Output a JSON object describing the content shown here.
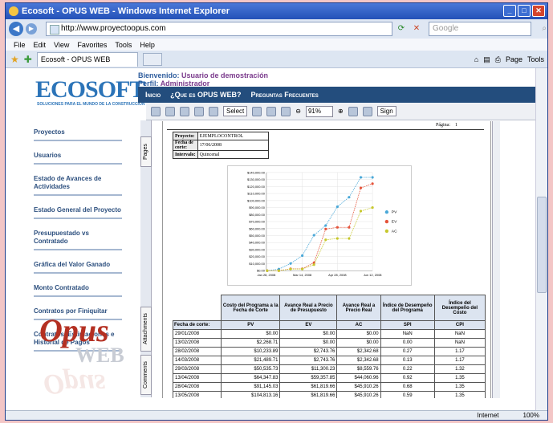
{
  "browser": {
    "title": "Ecosoft - OPUS WEB - Windows Internet Explorer",
    "url": "http://www.proyectoopus.com",
    "search_placeholder": "Google",
    "menu": [
      "File",
      "Edit",
      "View",
      "Favorites",
      "Tools",
      "Help"
    ],
    "tab_label": "Ecosoft - OPUS WEB",
    "cmd_page": "Page",
    "cmd_tools": "Tools",
    "status_zone": "Internet",
    "status_zoom": "100%"
  },
  "site": {
    "logo": "ECOSOFT",
    "logo_tagline": "SOLUCIONES PARA EL MUNDO DE LA CONSTRUCCION",
    "welcome_label": "Bienvenido:",
    "welcome_user": "Usuario de demostración",
    "profile_label": "Perfil:",
    "profile_value": "Administrador",
    "nav": [
      "Inicio",
      "¿Que es OPUS WEB?",
      "Preguntas Frecuentes"
    ],
    "sidebar": [
      "Proyectos",
      "Usuarios",
      "Estado de Avances de Actividades",
      "Estado General del Proyecto",
      "Presupuestado vs Contratado",
      "Gráfica del Valor Ganado",
      "Monto Contratado",
      "Contratos por Finiquitar",
      "Contratos, Estimaciones e Historial de Pagos"
    ],
    "brand_opus": "Opus",
    "brand_web": "WEB"
  },
  "pdf_toolbar": {
    "select_label": "Select",
    "zoom": "91%",
    "sign_label": "Sign",
    "tabs": [
      "Pages",
      "Attachments",
      "Comments"
    ]
  },
  "report": {
    "page_label": "Página:",
    "page_number": "1",
    "info": [
      {
        "key": "Proyecto:",
        "value": "EJEMPLOCONTROL"
      },
      {
        "key": "Fecha de corte:",
        "value": "17/06/2008"
      },
      {
        "key": "Intervalo:",
        "value": "Quincenal"
      }
    ],
    "table_headers": [
      "Costo del Programa a la Fecha de Corte",
      "Avance Real a Precio de Presupuesto",
      "Avance Real a Precio Real",
      "Índice de Desempeño del Programa",
      "Índice del Desempeño del Costo"
    ],
    "table_subheaders": [
      "Fecha de corte:",
      "PV",
      "EV",
      "AC",
      "SPI",
      "CPI"
    ],
    "rows": [
      [
        "29/01/2008",
        "$0.00",
        "$0.00",
        "$0.00",
        "NaN",
        "NaN"
      ],
      [
        "13/02/2008",
        "$2,268.71",
        "$0.00",
        "$0.00",
        "0.00",
        "NaN"
      ],
      [
        "28/02/2008",
        "$10,233.89",
        "$2,743.76",
        "$2,342.68",
        "0.27",
        "1.17"
      ],
      [
        "14/03/2008",
        "$21,489.71",
        "$2,743.76",
        "$2,342.68",
        "0.13",
        "1.17"
      ],
      [
        "29/03/2008",
        "$50,535.73",
        "$11,300.23",
        "$8,559.76",
        "0.22",
        "1.32"
      ],
      [
        "13/04/2008",
        "$64,347.83",
        "$59,357.85",
        "$44,060.96",
        "0.92",
        "1.35"
      ],
      [
        "28/04/2008",
        "$91,145.03",
        "$61,819.66",
        "$45,910.26",
        "0.68",
        "1.35"
      ],
      [
        "13/05/2008",
        "$104,813.16",
        "$61,819.66",
        "$45,910.26",
        "0.59",
        "1.35"
      ]
    ]
  },
  "chart_data": {
    "type": "line",
    "x_ticks": [
      "Jan 28, 2008",
      "Mar 14, 2008",
      "Apr 28, 2008",
      "Jun 12, 2008"
    ],
    "y_ticks": [
      "$0.00",
      "$10,000.00",
      "$20,000.00",
      "$30,000.00",
      "$40,000.00",
      "$50,000.00",
      "$60,000.00",
      "$70,000.00",
      "$80,000.00",
      "$90,000.00",
      "$100,000.00",
      "$110,000.00",
      "$120,000.00",
      "$130,000.00",
      "$140,000.00"
    ],
    "ylim": [
      0,
      140000
    ],
    "x_dates": [
      "2008-01-29",
      "2008-02-13",
      "2008-02-28",
      "2008-03-14",
      "2008-03-29",
      "2008-04-13",
      "2008-04-28",
      "2008-05-13",
      "2008-05-28",
      "2008-06-12"
    ],
    "series": [
      {
        "name": "PV",
        "color": "#4aa8d8",
        "values": [
          0,
          2268.71,
          10233.89,
          21489.71,
          50535.73,
          64347.83,
          91145.03,
          104813.16,
          133000,
          133000
        ]
      },
      {
        "name": "EV",
        "color": "#e5533a",
        "values": [
          0,
          0,
          2743.76,
          2743.76,
          11300.23,
          59357.85,
          61819.66,
          61819.66,
          118000,
          124000
        ]
      },
      {
        "name": "AC",
        "color": "#c7c82e",
        "values": [
          0,
          0,
          2342.68,
          2342.68,
          8559.76,
          44060.96,
          45910.26,
          45910.26,
          85000,
          90000
        ]
      }
    ],
    "legend": "right",
    "grid": true
  }
}
